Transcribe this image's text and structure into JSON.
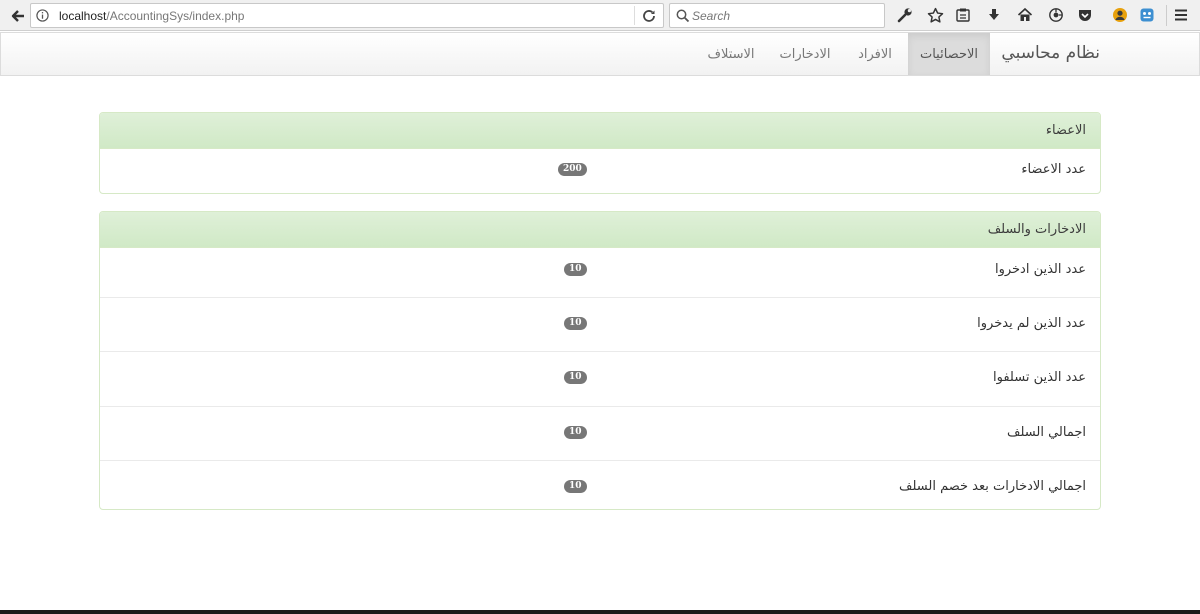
{
  "browser": {
    "url_host": "localhost",
    "url_path": "/AccountingSys/index.php",
    "search_placeholder": "Search",
    "toolbar_icons": [
      "wrench-icon",
      "bookmark-star-icon",
      "reading-list-icon",
      "download-icon",
      "home-icon",
      "pocket-sync-icon",
      "pocket-icon",
      "firefox-account-icon",
      "extension-icon",
      "hamburger-menu-icon"
    ]
  },
  "navbar": {
    "brand": "نظام محاسبي",
    "items": [
      {
        "label": "الاحصائيات",
        "active": true
      },
      {
        "label": "الافراد",
        "active": false
      },
      {
        "label": "الادخارات",
        "active": false
      },
      {
        "label": "الاستلاف",
        "active": false
      }
    ]
  },
  "members_panel": {
    "title": "الاعضاء",
    "rows": [
      {
        "label": "عدد الاعضاء",
        "count": "200"
      }
    ]
  },
  "savings_panel": {
    "title": "الادخارات والسلف",
    "rows": [
      {
        "label": "عدد الذين ادخروا",
        "count": "10"
      },
      {
        "label": "عدد الذين لم يدخروا",
        "count": "10"
      },
      {
        "label": "عدد الذين تسلفوا",
        "count": "10"
      },
      {
        "label": "اجمالي السلف",
        "count": "10"
      },
      {
        "label": "اجمالي الادخارات بعد خصم السلف",
        "count": "10"
      }
    ]
  },
  "colors": {
    "panel_heading": "#dff0d8",
    "panel_border": "#d6e9c6",
    "badge": "#777777",
    "nav_active": "#dcdcdc"
  }
}
